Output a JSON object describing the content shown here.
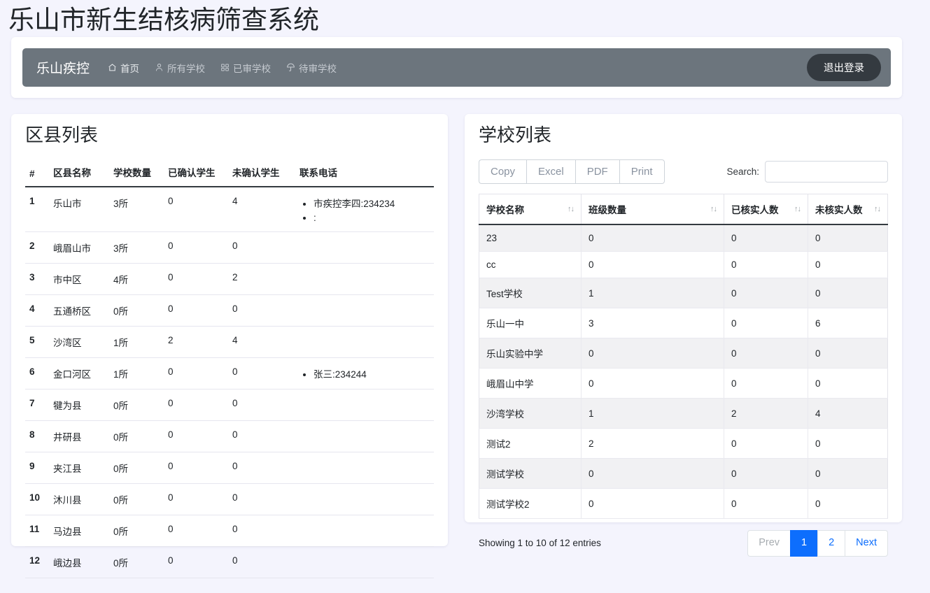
{
  "page": {
    "title": "乐山市新生结核病筛查系统"
  },
  "navbar": {
    "brand": "乐山疾控",
    "links": [
      {
        "label": "首页",
        "icon": "home-icon"
      },
      {
        "label": "所有学校",
        "icon": "user-icon"
      },
      {
        "label": "已审学校",
        "icon": "grid-icon"
      },
      {
        "label": "待审学校",
        "icon": "umbrella-icon"
      }
    ],
    "logout_label": "退出登录",
    "bg_color": "#6c757d",
    "logout_color": "#343a40"
  },
  "district_panel": {
    "title": "区县列表",
    "columns": [
      "#",
      "区县名称",
      "学校数量",
      "已确认学生",
      "未确认学生",
      "联系电话"
    ],
    "rows": [
      {
        "idx": "1",
        "name": "乐山市",
        "schools": "3所",
        "confirmed": "0",
        "unconfirmed": "4",
        "contacts": [
          "市疾控李四:234234",
          ":"
        ]
      },
      {
        "idx": "2",
        "name": "峨眉山市",
        "schools": "3所",
        "confirmed": "0",
        "unconfirmed": "0",
        "contacts": []
      },
      {
        "idx": "3",
        "name": "市中区",
        "schools": "4所",
        "confirmed": "0",
        "unconfirmed": "2",
        "contacts": []
      },
      {
        "idx": "4",
        "name": "五通桥区",
        "schools": "0所",
        "confirmed": "0",
        "unconfirmed": "0",
        "contacts": []
      },
      {
        "idx": "5",
        "name": "沙湾区",
        "schools": "1所",
        "confirmed": "2",
        "unconfirmed": "4",
        "contacts": []
      },
      {
        "idx": "6",
        "name": "金口河区",
        "schools": "1所",
        "confirmed": "0",
        "unconfirmed": "0",
        "contacts": [
          "张三:234244"
        ]
      },
      {
        "idx": "7",
        "name": "犍为县",
        "schools": "0所",
        "confirmed": "0",
        "unconfirmed": "0",
        "contacts": []
      },
      {
        "idx": "8",
        "name": "井研县",
        "schools": "0所",
        "confirmed": "0",
        "unconfirmed": "0",
        "contacts": []
      },
      {
        "idx": "9",
        "name": "夹江县",
        "schools": "0所",
        "confirmed": "0",
        "unconfirmed": "0",
        "contacts": []
      },
      {
        "idx": "10",
        "name": "沐川县",
        "schools": "0所",
        "confirmed": "0",
        "unconfirmed": "0",
        "contacts": []
      },
      {
        "idx": "11",
        "name": "马边县",
        "schools": "0所",
        "confirmed": "0",
        "unconfirmed": "0",
        "contacts": []
      },
      {
        "idx": "12",
        "name": "峨边县",
        "schools": "0所",
        "confirmed": "0",
        "unconfirmed": "0",
        "contacts": []
      }
    ]
  },
  "school_panel": {
    "title": "学校列表",
    "export_buttons": [
      "Copy",
      "Excel",
      "PDF",
      "Print"
    ],
    "search": {
      "label": "Search:",
      "value": "",
      "placeholder": ""
    },
    "columns": [
      "学校名称",
      "班级数量",
      "已核实人数",
      "未核实人数"
    ],
    "sort_icon": "↑↓",
    "rows": [
      {
        "name": "23",
        "classes": "0",
        "verified": "0",
        "unverified": "0"
      },
      {
        "name": "cc",
        "classes": "0",
        "verified": "0",
        "unverified": "0"
      },
      {
        "name": "Test学校",
        "classes": "1",
        "verified": "0",
        "unverified": "0"
      },
      {
        "name": "乐山一中",
        "classes": "3",
        "verified": "0",
        "unverified": "6"
      },
      {
        "name": "乐山实验中学",
        "classes": "0",
        "verified": "0",
        "unverified": "0"
      },
      {
        "name": "峨眉山中学",
        "classes": "0",
        "verified": "0",
        "unverified": "0"
      },
      {
        "name": "沙湾学校",
        "classes": "1",
        "verified": "2",
        "unverified": "4"
      },
      {
        "name": "测试2",
        "classes": "2",
        "verified": "0",
        "unverified": "0"
      },
      {
        "name": "测试学校",
        "classes": "0",
        "verified": "0",
        "unverified": "0"
      },
      {
        "name": "测试学校2",
        "classes": "0",
        "verified": "0",
        "unverified": "0"
      }
    ],
    "info": "Showing 1 to 10 of 12 entries",
    "pagination": {
      "prev": "Prev",
      "pages": [
        "1",
        "2"
      ],
      "active_page": "1",
      "next": "Next",
      "active_color": "#0d6efd"
    }
  }
}
